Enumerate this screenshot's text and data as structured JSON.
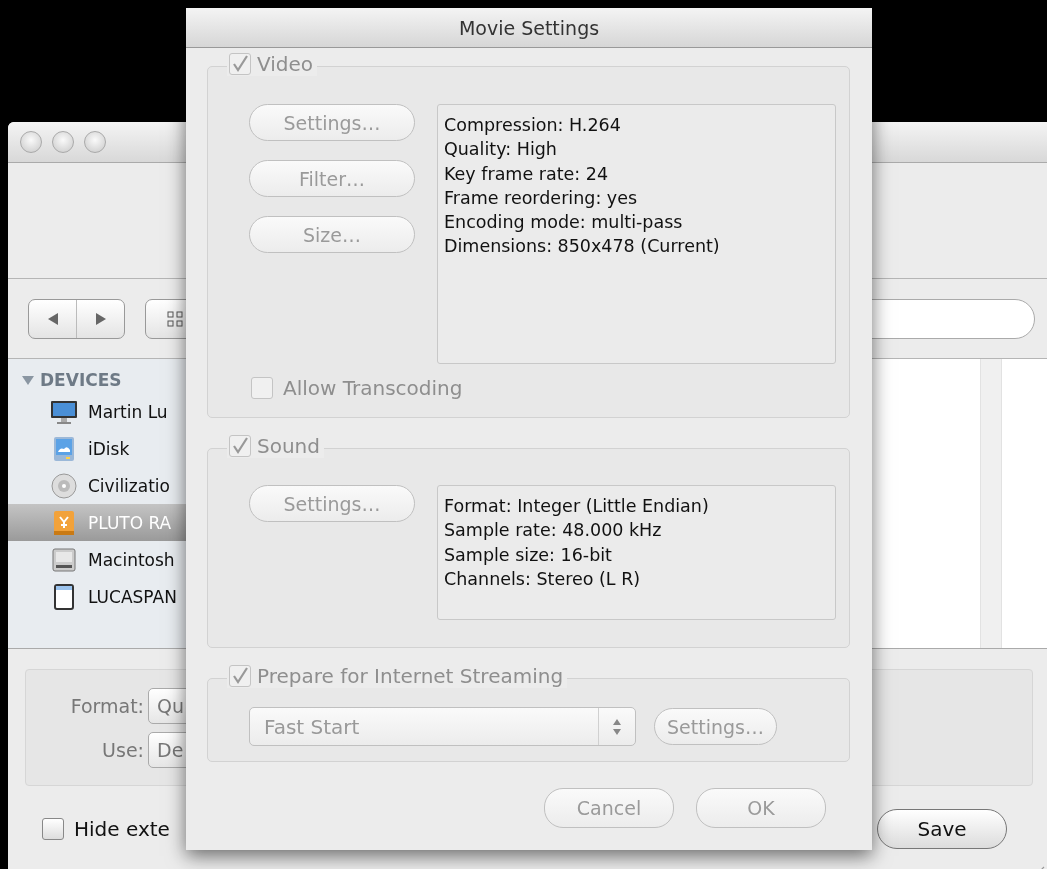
{
  "background_window": {
    "sidebar": [
      {
        "title": "DEVICES",
        "expanded": true,
        "items": [
          {
            "label": "Martin Lu",
            "kind": "computer",
            "selected": false
          },
          {
            "label": "iDisk",
            "kind": "idisk",
            "selected": false
          },
          {
            "label": "Civilizatio",
            "kind": "disc",
            "selected": false
          },
          {
            "label": "PLUTO RA",
            "kind": "network-drive",
            "selected": true
          },
          {
            "label": "Macintosh",
            "kind": "harddisk",
            "selected": false
          },
          {
            "label": "LUCASPAN",
            "kind": "device",
            "selected": false
          }
        ]
      }
    ],
    "format_label": "Format:",
    "format_value": "Qu",
    "use_label": "Use:",
    "use_value": "De",
    "hide_extension": {
      "label": "Hide exte",
      "checked": false
    },
    "save_button": "Save"
  },
  "dialog": {
    "title": "Movie Settings",
    "groups": [
      {
        "kind": "video",
        "label": "Video",
        "checked": true,
        "disabled": true,
        "buttons": [
          {
            "label": "Settings…",
            "disabled": true
          },
          {
            "label": "Filter…",
            "disabled": true
          },
          {
            "label": "Size…",
            "disabled": true
          }
        ],
        "info": [
          "Compression: H.264",
          "Quality: High",
          "Key frame rate: 24",
          "Frame reordering: yes",
          "Encoding mode: multi-pass",
          "Dimensions: 850x478 (Current)"
        ],
        "option": {
          "label": "Allow Transcoding",
          "checked": false,
          "disabled": true
        }
      },
      {
        "kind": "sound",
        "label": "Sound",
        "checked": true,
        "disabled": true,
        "buttons": [
          {
            "label": "Settings…",
            "disabled": true
          }
        ],
        "info": [
          "Format: Integer (Little Endian)",
          "Sample rate: 48.000 kHz",
          "Sample size: 16-bit",
          "Channels: Stereo (L R)"
        ]
      },
      {
        "kind": "streaming",
        "label": "Prepare for Internet Streaming",
        "checked": true,
        "disabled": true,
        "select": "Fast Start",
        "buttons": [
          {
            "label": "Settings…",
            "disabled": true
          }
        ]
      }
    ],
    "buttons": [
      {
        "label": "Cancel",
        "disabled": true
      },
      {
        "label": "OK",
        "disabled": true
      }
    ]
  }
}
